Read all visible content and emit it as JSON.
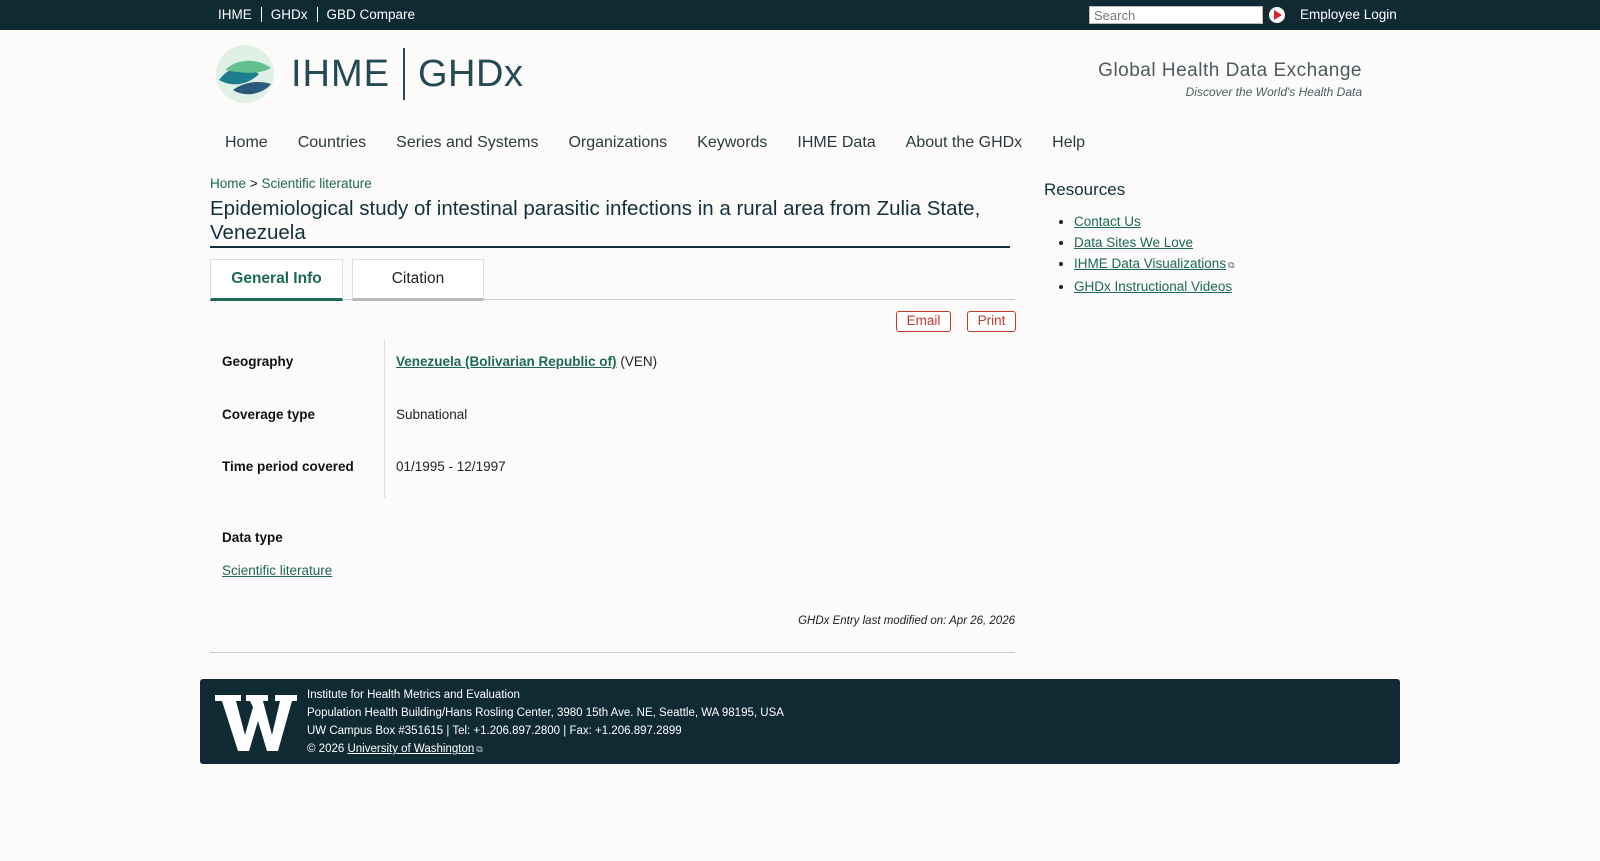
{
  "topbar": {
    "links": [
      "IHME",
      "GHDx",
      "GBD Compare"
    ],
    "search_placeholder": "Search",
    "employee_login": "Employee Login"
  },
  "header": {
    "logo_ihme": "IHME",
    "logo_ghdx": "GHDx",
    "tagline_title": "Global Health Data Exchange",
    "tagline_subtitle": "Discover the World's Health Data"
  },
  "nav": [
    "Home",
    "Countries",
    "Series and Systems",
    "Organizations",
    "Keywords",
    "IHME Data",
    "About the GHDx",
    "Help"
  ],
  "breadcrumb": {
    "home": "Home",
    "separator": ">",
    "section": "Scientific literature"
  },
  "page_title": "Epidemiological study of intestinal parasitic infections in a rural area from Zulia State, Venezuela",
  "tabs": [
    {
      "label": "General Info",
      "active": true
    },
    {
      "label": "Citation",
      "active": false
    }
  ],
  "actions": {
    "email": "Email",
    "print": "Print"
  },
  "info": {
    "geography_label": "Geography",
    "geography_link": "Venezuela (Bolivarian Republic of)",
    "geography_code": "(VEN)",
    "coverage_label": "Coverage type",
    "coverage_value": "Subnational",
    "time_label": "Time period covered",
    "time_value": "01/1995 - 12/1997",
    "data_type_label": "Data type",
    "data_type_value": "Scientific literature"
  },
  "last_modified": "GHDx Entry last modified on: Apr 26, 2026",
  "sidebar": {
    "title": "Resources",
    "links": [
      "Contact Us",
      "Data Sites We Love",
      "IHME Data Visualizations",
      "GHDx Instructional Videos"
    ]
  },
  "footer": {
    "org": "Institute for Health Metrics and Evaluation",
    "address": "Population Health Building/Hans Rosling Center, 3980 15th Ave. NE, Seattle, WA 98195, USA",
    "contact": "UW Campus Box #351615 | Tel: +1.206.897.2800 | Fax: +1.206.897.2899",
    "copyright": "© 2026",
    "uw_link": "University of Washington"
  },
  "colors": {
    "topbar": "#0f2a33",
    "link_green": "#1a6b4f",
    "action_red": "#c0392b"
  }
}
